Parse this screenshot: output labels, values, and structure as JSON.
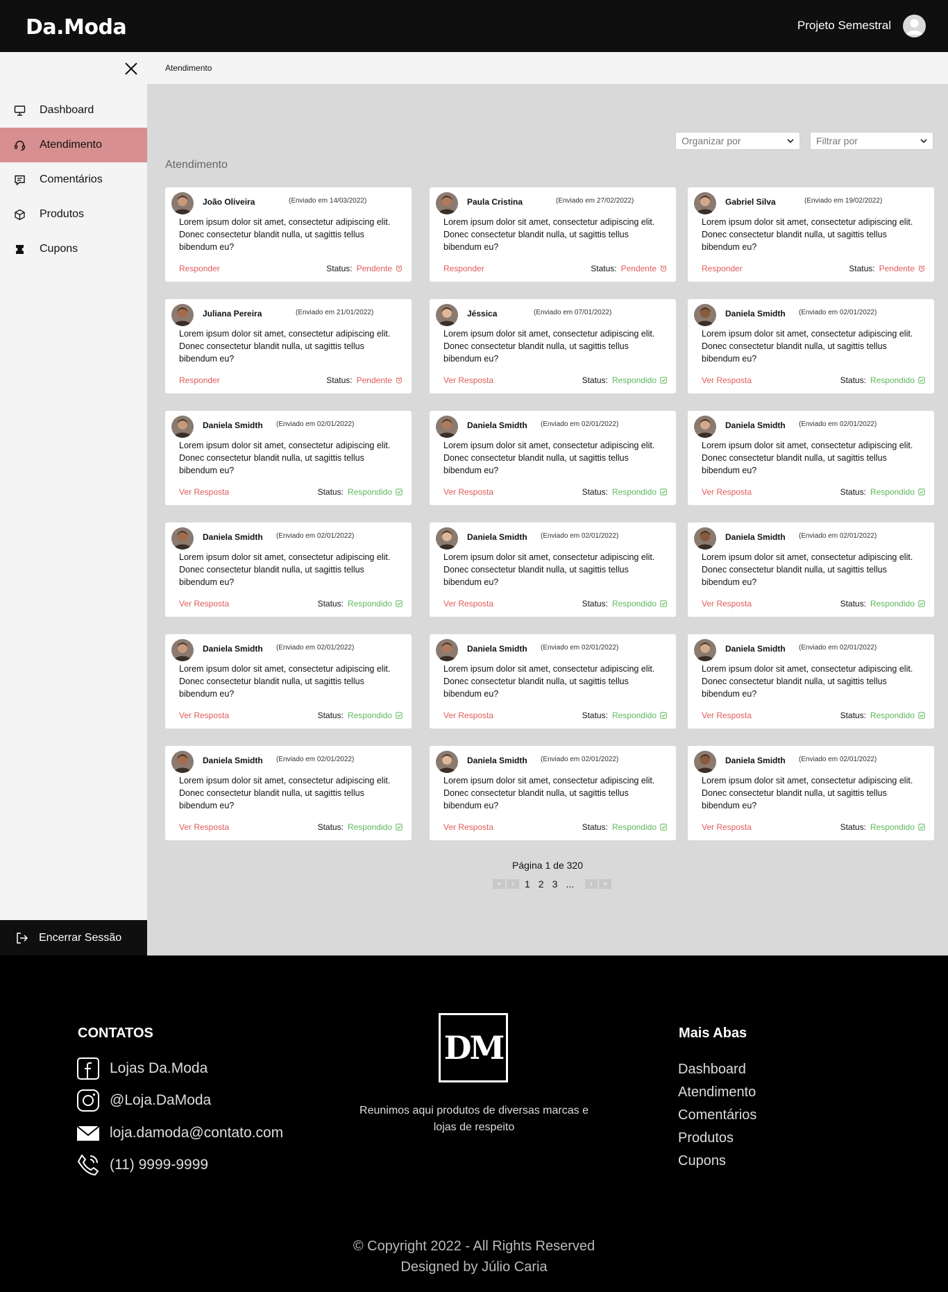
{
  "header": {
    "logo": "Da.Moda",
    "project": "Projeto Semestral"
  },
  "sidebar": {
    "items": [
      {
        "label": "Dashboard",
        "icon": "monitor-icon"
      },
      {
        "label": "Atendimento",
        "icon": "headset-icon"
      },
      {
        "label": "Comentários",
        "icon": "comment-icon"
      },
      {
        "label": "Produtos",
        "icon": "box-icon"
      },
      {
        "label": "Cupons",
        "icon": "coupon-icon"
      }
    ],
    "logout": "Encerrar Sessão"
  },
  "breadcrumb": "Atendimento",
  "filters": {
    "sort": "Organizar por",
    "filter": "Filtrar por"
  },
  "section_title": "Atendimento",
  "message": "Lorem ipsum dolor sit amet, consectetur adipiscing elit. Donec consectetur blandit nulla, ut sagittis tellus bibendum eu?",
  "status_label": "Status:",
  "cards": [
    {
      "name": "João Oliveira",
      "date": "(Enviado em 14/03/2022)",
      "action": "Responder",
      "status": "Pendente",
      "state": "pending"
    },
    {
      "name": "Paula Cristina",
      "date": "(Enviado em 27/02/2022)",
      "action": "Responder",
      "status": "Pendente",
      "state": "pending"
    },
    {
      "name": "Gabriel Silva",
      "date": "(Enviado em 19/02/2022)",
      "action": "Responder",
      "status": "Pendente",
      "state": "pending"
    },
    {
      "name": "Juliana Pereira",
      "date": "(Enviado em 21/01/2022)",
      "action": "Responder",
      "status": "Pendente",
      "state": "pending"
    },
    {
      "name": "Jéssica",
      "date": "(Enviado em 07/01/2022)",
      "action": "Ver Resposta",
      "status": "Respondido",
      "state": "done"
    },
    {
      "name": "Daniela Smidth",
      "date": "(Enviado em 02/01/2022)",
      "action": "Ver Resposta",
      "status": "Respondido",
      "state": "done"
    },
    {
      "name": "Daniela Smidth",
      "date": "(Enviado em 02/01/2022)",
      "action": "Ver Resposta",
      "status": "Respondido",
      "state": "done"
    },
    {
      "name": "Daniela Smidth",
      "date": "(Enviado em 02/01/2022)",
      "action": "Ver Resposta",
      "status": "Respondido",
      "state": "done"
    },
    {
      "name": "Daniela Smidth",
      "date": "(Enviado em 02/01/2022)",
      "action": "Ver Resposta",
      "status": "Respondido",
      "state": "done"
    },
    {
      "name": "Daniela Smidth",
      "date": "(Enviado em 02/01/2022)",
      "action": "Ver Resposta",
      "status": "Respondido",
      "state": "done"
    },
    {
      "name": "Daniela Smidth",
      "date": "(Enviado em 02/01/2022)",
      "action": "Ver Resposta",
      "status": "Respondido",
      "state": "done"
    },
    {
      "name": "Daniela Smidth",
      "date": "(Enviado em 02/01/2022)",
      "action": "Ver Resposta",
      "status": "Respondido",
      "state": "done"
    },
    {
      "name": "Daniela Smidth",
      "date": "(Enviado em 02/01/2022)",
      "action": "Ver Resposta",
      "status": "Respondido",
      "state": "done"
    },
    {
      "name": "Daniela Smidth",
      "date": "(Enviado em 02/01/2022)",
      "action": "Ver Resposta",
      "status": "Respondido",
      "state": "done"
    },
    {
      "name": "Daniela Smidth",
      "date": "(Enviado em 02/01/2022)",
      "action": "Ver Resposta",
      "status": "Respondido",
      "state": "done"
    },
    {
      "name": "Daniela Smidth",
      "date": "(Enviado em 02/01/2022)",
      "action": "Ver Resposta",
      "status": "Respondido",
      "state": "done"
    },
    {
      "name": "Daniela Smidth",
      "date": "(Enviado em 02/01/2022)",
      "action": "Ver Resposta",
      "status": "Respondido",
      "state": "done"
    },
    {
      "name": "Daniela Smidth",
      "date": "(Enviado em 02/01/2022)",
      "action": "Ver Resposta",
      "status": "Respondido",
      "state": "done"
    }
  ],
  "pagination": {
    "text": "Página 1 de 320",
    "first": "«",
    "prev": "‹",
    "pages": [
      "1",
      "2",
      "3",
      "..."
    ],
    "next": "›",
    "last": "»"
  },
  "footer": {
    "contacts_title": "CONTATOS",
    "contacts": [
      {
        "text": "Lojas Da.Moda",
        "icon": "facebook-icon"
      },
      {
        "text": "@Loja.DaModa",
        "icon": "instagram-icon"
      },
      {
        "text": "loja.damoda@contato.com",
        "icon": "mail-icon"
      },
      {
        "text": "(11) 9999-9999",
        "icon": "phone-icon"
      }
    ],
    "brand_mark": "DM",
    "tagline": "Reunimos aqui produtos de diversas marcas e lojas de respeito",
    "tabs_title": "Mais Abas",
    "tabs": [
      "Dashboard",
      "Atendimento",
      "Comentários",
      "Produtos",
      "Cupons"
    ],
    "copyright": "© Copyright 2022 - All Rights Reserved",
    "designer": "Designed by Júlio Caria"
  },
  "colors": {
    "accent": "#d88f8f",
    "pending": "#e05a5a",
    "done": "#5cb85c",
    "dark": "#0f0f0f",
    "panel": "#d9d9d9"
  }
}
